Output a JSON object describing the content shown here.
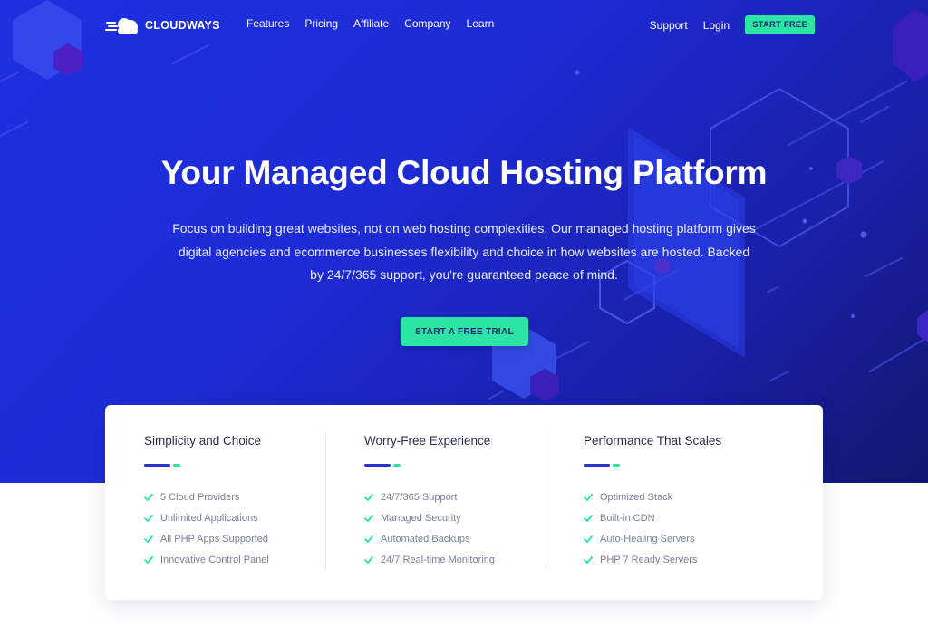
{
  "brand": {
    "name": "CLOUDWAYS"
  },
  "nav": {
    "links": [
      "Features",
      "Pricing",
      "Affiliate",
      "Company",
      "Learn"
    ],
    "support": "Support",
    "login": "Login",
    "cta": "START FREE"
  },
  "hero": {
    "title": "Your Managed Cloud Hosting Platform",
    "subtitle_lines": [
      "Focus on building great websites, not on web hosting complexities. Our managed hosting platform gives",
      "digital agencies and ecommerce businesses flexibility and choice in how websites are hosted. Backed",
      "by 24/7/365 support, you're guaranteed peace of mind."
    ],
    "cta": "START A FREE TRIAL"
  },
  "features": [
    {
      "title": "Simplicity and Choice",
      "items": [
        "5 Cloud Providers",
        "Unlimited Applications",
        "All PHP Apps Supported",
        "Innovative Control Panel"
      ]
    },
    {
      "title": "Worry-Free Experience",
      "items": [
        "24/7/365 Support",
        "Managed Security",
        "Automated Backups",
        "24/7 Real-time Monitoring"
      ]
    },
    {
      "title": "Performance That Scales",
      "items": [
        "Optimized Stack",
        "Built-in CDN",
        "Auto-Healing Servers",
        "PHP 7 Ready Servers"
      ]
    }
  ],
  "colors": {
    "accent_green": "#2ce5a5",
    "bar_blue": "#2b33c9",
    "check_green": "#2ce5a5",
    "hero_blue": "#1f2fe0"
  },
  "icons": {
    "check": "check-icon",
    "logo": "cloud-logo-icon"
  }
}
